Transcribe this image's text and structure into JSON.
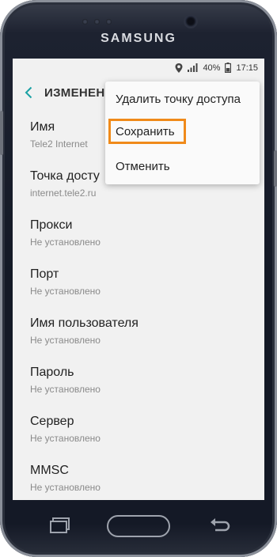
{
  "device": {
    "brand": "SAMSUNG"
  },
  "status_bar": {
    "battery": "40%",
    "time": "17:15"
  },
  "app_bar": {
    "back_icon": "chevron-left-icon",
    "title": "ИЗМЕНЕН"
  },
  "settings": [
    {
      "label": "Имя",
      "value": "Tele2 Internet"
    },
    {
      "label": "Точка досту",
      "value": "internet.tele2.ru"
    },
    {
      "label": "Прокси",
      "value": "Не установлено"
    },
    {
      "label": "Порт",
      "value": "Не установлено"
    },
    {
      "label": "Имя пользователя",
      "value": "Не установлено"
    },
    {
      "label": "Пароль",
      "value": "Не установлено"
    },
    {
      "label": "Сервер",
      "value": "Не установлено"
    },
    {
      "label": "MMSC",
      "value": "Не установлено"
    }
  ],
  "menu": {
    "items": [
      "Удалить точку доступа",
      "Сохранить",
      "Отменить"
    ],
    "highlighted": "Сохранить",
    "highlight_color": "#f08a1a"
  },
  "colors": {
    "accent": "#1aa1a4"
  }
}
